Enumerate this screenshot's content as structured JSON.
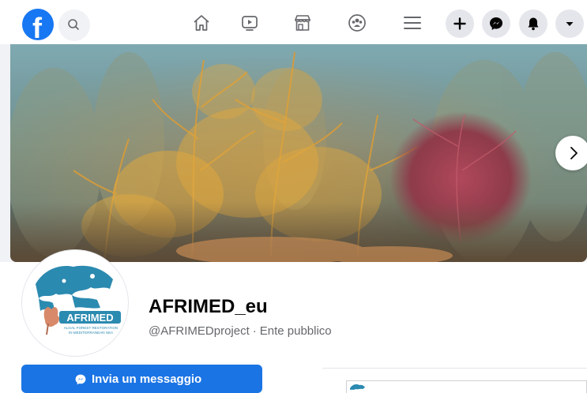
{
  "page": {
    "name": "AFRIMED_eu",
    "handle": "@AFRIMEDproject",
    "separator": "·",
    "category": "Ente pubblico"
  },
  "logo": {
    "wordmark": "AFRIMED",
    "tagline_1": "ALGAL FOREST RESTORATION",
    "tagline_2": "IN MEDITERRANEAN SEA"
  },
  "actions": {
    "message_label": "Invia un messaggio"
  },
  "colors": {
    "brand": "#1877f2",
    "button": "#1b74e4",
    "text_secondary": "#65676b",
    "logo_teal": "#2b8ab0"
  },
  "icons": {
    "facebook": "facebook-logo-icon",
    "search": "search-icon",
    "home": "home-icon",
    "watch": "watch-video-icon",
    "marketplace": "marketplace-icon",
    "groups": "groups-icon",
    "menu": "menu-icon",
    "create": "plus-icon",
    "messenger": "messenger-icon",
    "notifications": "bell-icon",
    "account": "caret-down-icon",
    "next": "chevron-right-icon"
  }
}
